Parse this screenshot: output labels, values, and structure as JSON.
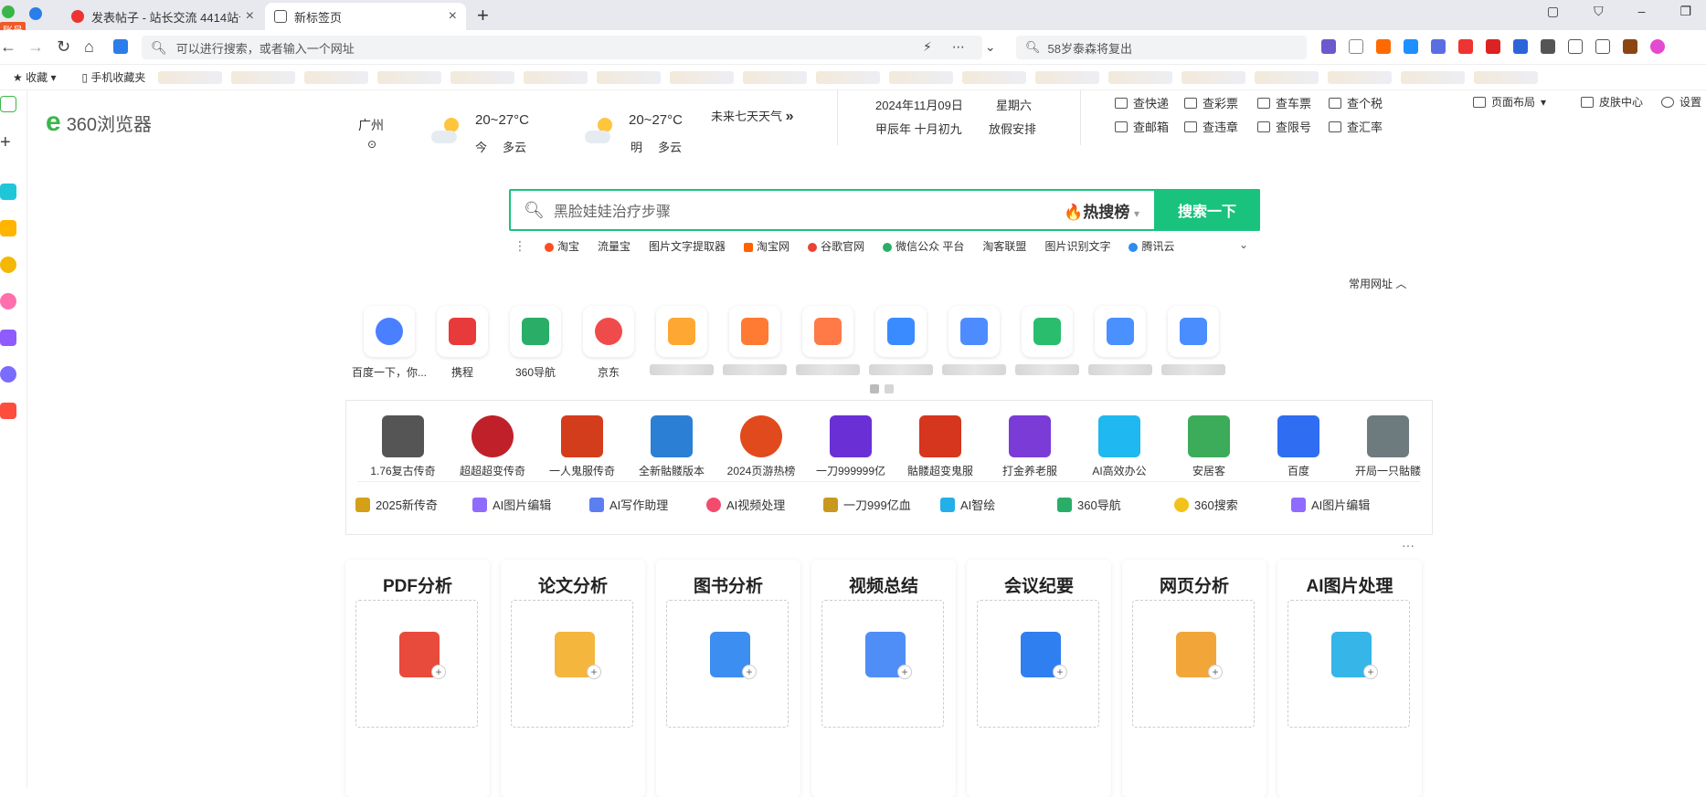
{
  "tabs": [
    {
      "title": "发表帖子 - 站长交流 4414站长",
      "active": false
    },
    {
      "title": "新标签页",
      "active": true
    }
  ],
  "account_badge": "账号",
  "address": {
    "placeholder": "可以进行搜索，或者输入一个网址"
  },
  "side_search": {
    "placeholder": "58岁泰森将复出"
  },
  "bookmarks": {
    "collect": "收藏",
    "mobile": "手机收藏夹"
  },
  "logo": {
    "text": "360浏览器"
  },
  "weather": {
    "city": "广州",
    "today": {
      "temp": "20~27°C",
      "label": "今",
      "cond": "多云"
    },
    "tomorrow": {
      "temp": "20~27°C",
      "label": "明",
      "cond": "多云"
    },
    "future": "未来七天天气"
  },
  "date": {
    "gregorian": "2024年11月09日",
    "weekday": "星期六",
    "lunar": "甲辰年 十月初九",
    "holiday": "放假安排"
  },
  "quick_tools": [
    [
      "查快递",
      "查彩票",
      "查车票",
      "查个税"
    ],
    [
      "查邮箱",
      "查违章",
      "查限号",
      "查汇率"
    ]
  ],
  "page_options": {
    "layout": "页面布局",
    "skin": "皮肤中心",
    "settings": "设置"
  },
  "search": {
    "placeholder": "黑脸娃娃治疗步骤",
    "hot": "热搜榜",
    "button": "搜索一下"
  },
  "hotlinks": [
    "淘宝",
    "流量宝",
    "图片文字提取器",
    "淘宝网",
    "谷歌官网",
    "微信公众 平台",
    "淘客联盟",
    "图片识别文字",
    "腾讯云"
  ],
  "common_url": "常用网址",
  "sites": [
    "百度一下，你...",
    "携程",
    "360导航",
    "京东"
  ],
  "games": [
    "1.76复古传奇",
    "超超超变传奇",
    "一人鬼服传奇",
    "全新骷髅版本",
    "2024页游热榜",
    "一刀999999亿",
    "骷髅超变鬼服",
    "打金养老服",
    "AI高效办公",
    "安居客",
    "百度",
    "开局一只骷髅"
  ],
  "games_row2": [
    "2025新传奇",
    "AI图片编辑",
    "AI写作助理",
    "AI视频处理",
    "一刀999亿血",
    "AI智绘",
    "360导航",
    "360搜索",
    "AI图片编辑"
  ],
  "ai_cards": [
    "PDF分析",
    "论文分析",
    "图书分析",
    "视频总结",
    "会议纪要",
    "网页分析",
    "AI图片处理"
  ],
  "colors": {
    "accent": "#19c37d",
    "brand": "#3bb54a"
  }
}
